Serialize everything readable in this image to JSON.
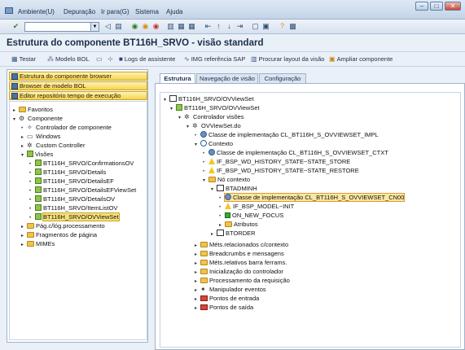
{
  "menubar": {
    "items": [
      "Ambiente(U)",
      "Depuração",
      "Ir para(G)",
      "Sistema",
      "Ajuda"
    ]
  },
  "toolbar": {
    "command_value": ""
  },
  "title": "Estrutura do componente BT116H_SRVO - visão standard",
  "app_toolbar": {
    "items": [
      "Testar",
      "Modelo BOL",
      "Logs de assistente",
      "IMG referência SAP",
      "Procurar layout da visão",
      "Ampliar componente"
    ]
  },
  "left_nav": {
    "buttons": [
      "Estrutura do componente browser",
      "Browser de modelo BOL",
      "Editor repositório tempo de execução"
    ],
    "tree": [
      "Favoritos",
      "Componente",
      "Controlador de componente",
      "Windows",
      "Custom Controller",
      "Visões",
      "BT116H_SRVO/ConfirmationsOV",
      "BT116H_SRVO/Details",
      "BT116H_SRVO/DetailsEF",
      "BT116H_SRVO/DetailsEFViewSet",
      "BT116H_SRVO/DetailsOV",
      "BT116H_SRVO/ItemListOV",
      "BT116H_SRVO/OVViewSet",
      "Pág.c/lóg.processamento",
      "Fragmentos de página",
      "MIMEs"
    ]
  },
  "tabs": [
    "Estrutura",
    "Navegação de visão",
    "Configuração"
  ],
  "right_tree": [
    "BT116H_SRVO/OVViewSet",
    "BT116H_SRVO/OVViewSet",
    "Controlador visões",
    "OVViewSet.do",
    "Classe de implementação CL_BT116H_S_OVVIEWSET_IMPL",
    "Contexto",
    "Classe de implementação CL_BT116H_S_OVVIEWSET_CTXT",
    "IF_BSP_WD_HISTORY_STATE~STATE_STORE",
    "IF_BSP_WD_HISTORY_STATE~STATE_RESTORE",
    "Nó contexto",
    "BTADMINH",
    "Classe de implementação CL_BT116H_S_OVVIEWSET_CN00",
    "IF_BSP_MODEL~INIT",
    "ON_NEW_FOCUS",
    "Atributos",
    "BTORDER",
    "Méts.relacionados c/contexto",
    "Breadcrumbs e mensagens",
    "Méts.relativos barra ferrams.",
    "Inicialização do controlador",
    "Processamento da requisição",
    "Manipulador eventos",
    "Pontos de entrada",
    "Pontos de saída"
  ]
}
